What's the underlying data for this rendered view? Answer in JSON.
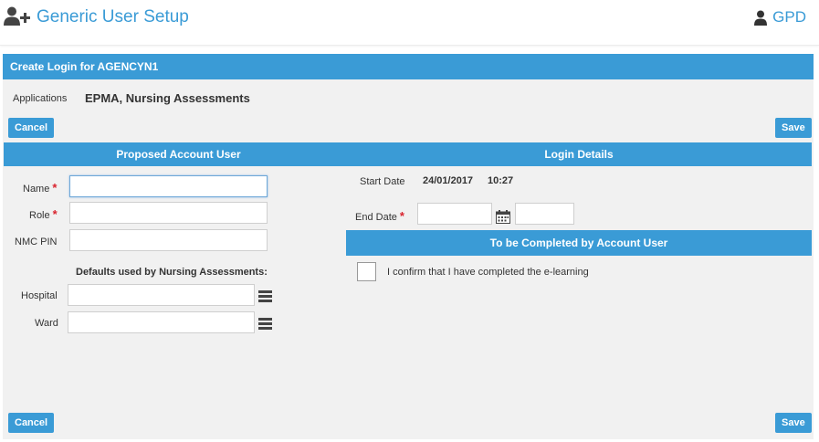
{
  "header": {
    "title": "Generic User Setup",
    "user": "GPD",
    "icons": {
      "app": "add-user-icon",
      "user": "user-icon"
    }
  },
  "panel": {
    "title": "Create Login for AGENCYN1",
    "applications_label": "Applications",
    "applications_value": "EPMA, Nursing Assessments"
  },
  "buttons": {
    "cancel": "Cancel",
    "save": "Save"
  },
  "proposed": {
    "title": "Proposed Account User",
    "name_label": "Name",
    "role_label": "Role",
    "nmc_label": "NMC PIN",
    "name_value": "",
    "role_value": "",
    "nmc_value": "",
    "defaults_title": "Defaults used by Nursing Assessments:",
    "hospital_label": "Hospital",
    "ward_label": "Ward",
    "hospital_value": "",
    "ward_value": ""
  },
  "login": {
    "title": "Login Details",
    "start_label": "Start Date",
    "start_date": "24/01/2017",
    "start_time": "10:27",
    "end_label": "End Date",
    "end_date_value": "",
    "end_time_value": ""
  },
  "tobe": {
    "title": "To be Completed by Account User",
    "confirm_text": "I confirm that I have completed the e-learning",
    "confirmed": false
  },
  "required_marker": "*",
  "colors": {
    "accent": "#3a9bd6",
    "required": "#d9232e",
    "panel_bg": "#f1f1f1"
  }
}
